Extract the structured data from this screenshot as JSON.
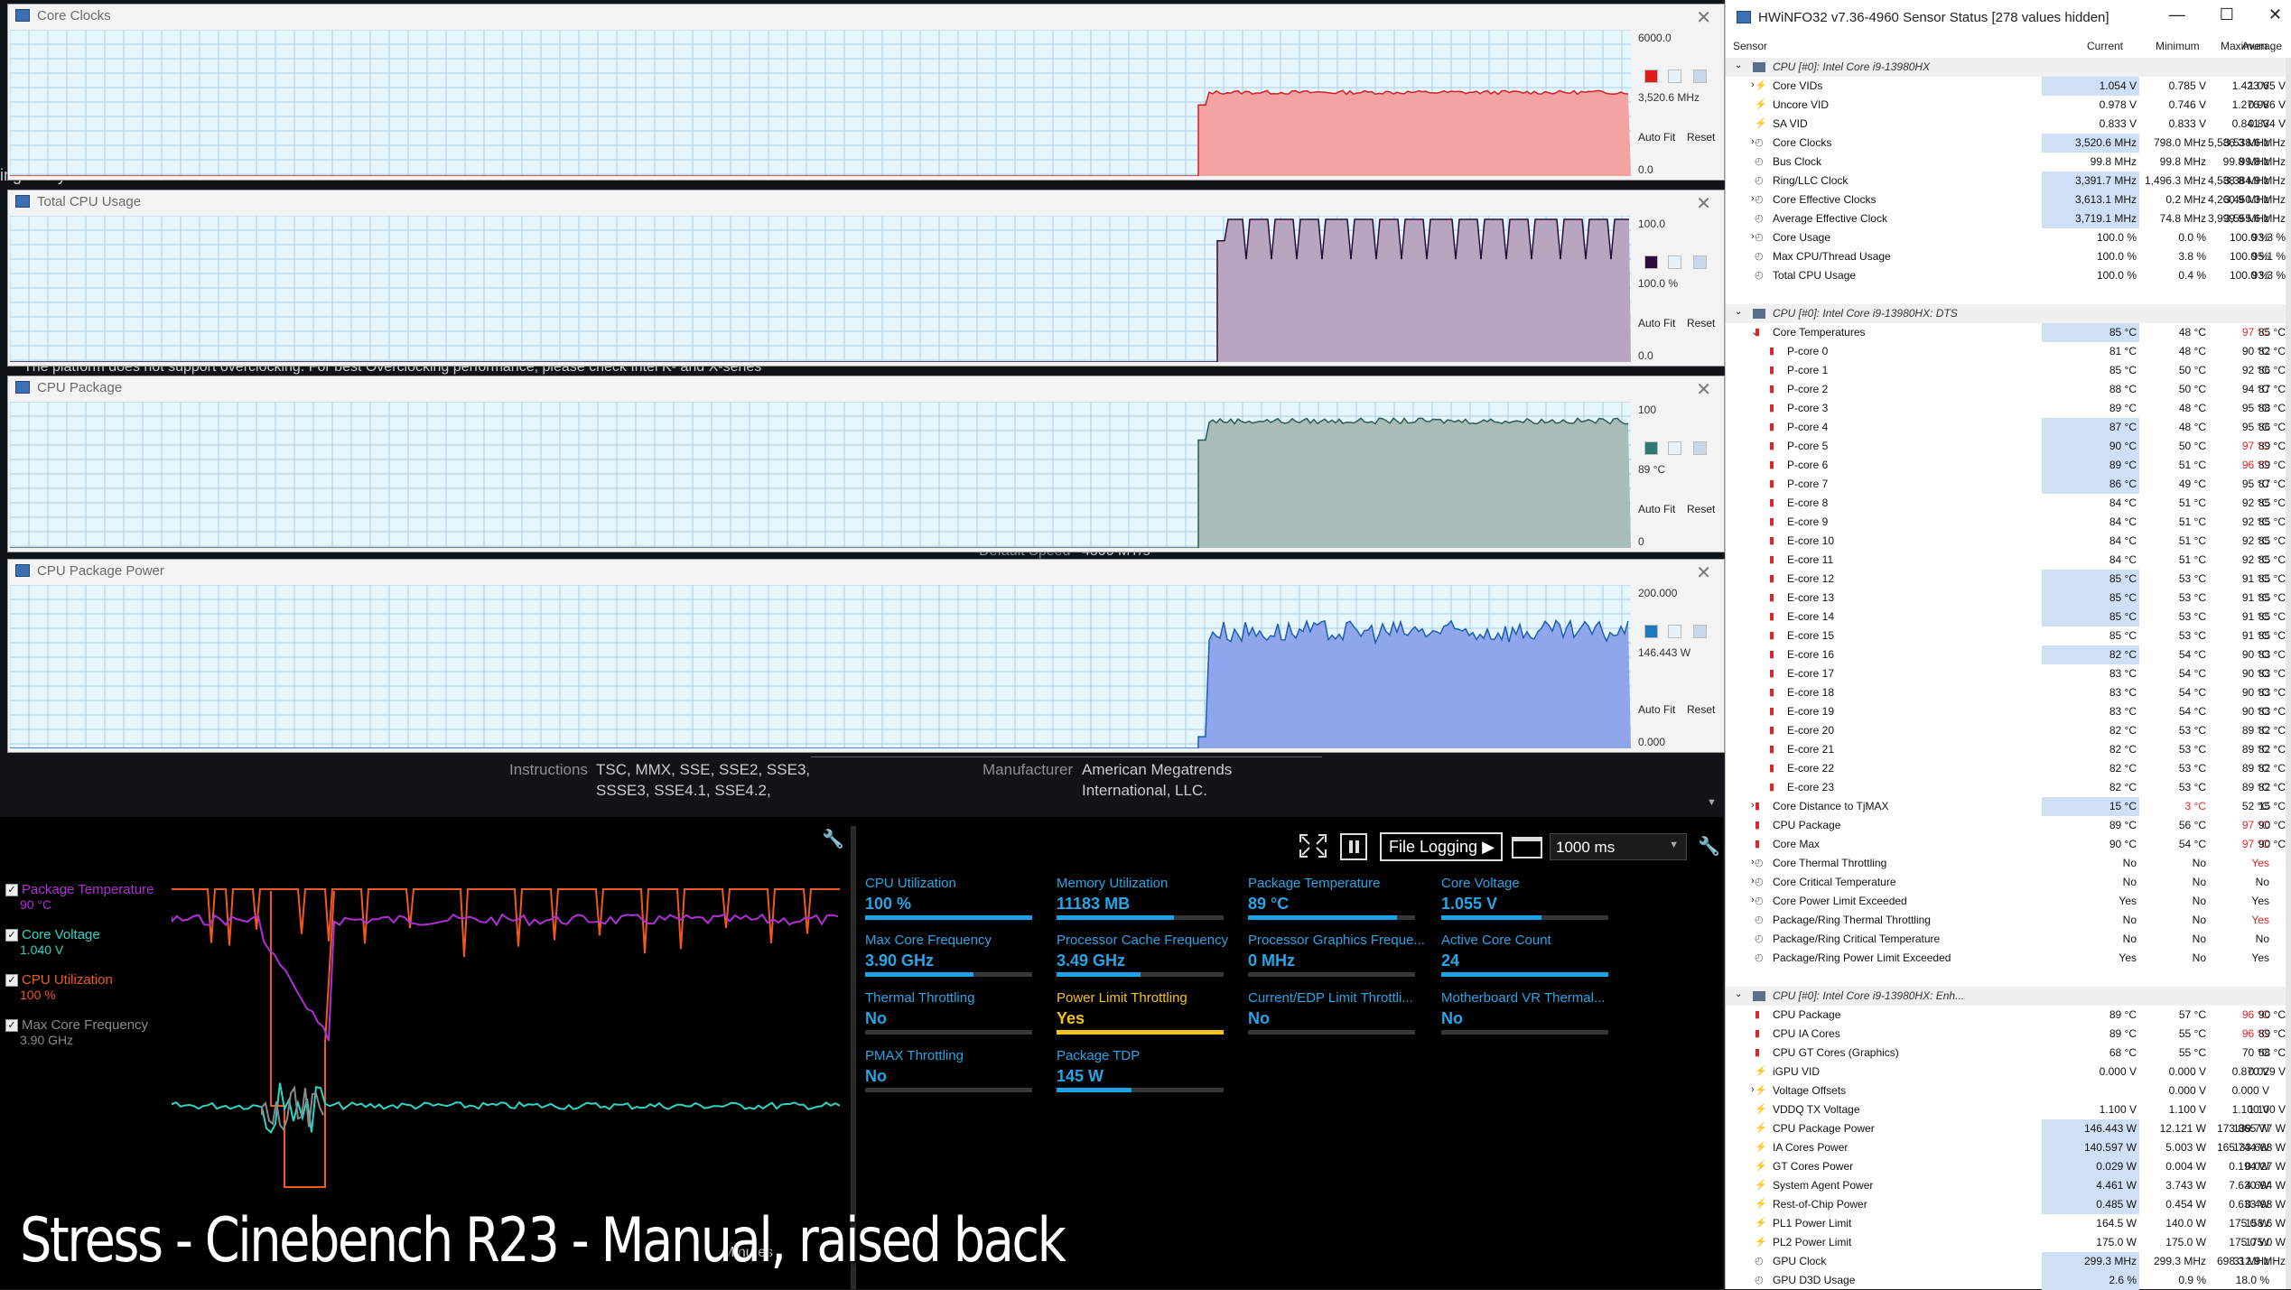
{
  "background_app": {
    "fragments": [
      {
        "text": "ing Utility",
        "cls": ""
      },
      {
        "text": "The platform does not support overclocking. For best Overclocking performance, please check Intel K- and X-series",
        "cls": ""
      },
      {
        "text": "Default Speed",
        "cls": "dim"
      },
      {
        "text": "4800 MT/s",
        "cls": ""
      },
      {
        "text": "Instructions",
        "cls": "dim"
      },
      {
        "text": "TSC, MMX, SSE, SSE2, SSE3,",
        "cls": ""
      },
      {
        "text": "SSSE3, SSE4.1, SSE4.2,",
        "cls": ""
      },
      {
        "text": "Manufacturer",
        "cls": "dim"
      },
      {
        "text": "American Megatrends",
        "cls": ""
      },
      {
        "text": "International, LLC.",
        "cls": ""
      }
    ]
  },
  "graph_windows": [
    {
      "title": "Core Clocks",
      "top_label": "6000.0",
      "current": "3,520.6 MHz",
      "bottom_label": "0.0",
      "autofit": "Auto Fit",
      "reset": "Reset",
      "line_color": "#d42020",
      "fill_color": "#f4a3a3",
      "swatch": "#e01b1b",
      "series": {
        "max": 6000,
        "idle": 0,
        "start_frac": 0.733,
        "level": 3520,
        "noise": 80,
        "dips": 0
      }
    },
    {
      "title": "Total CPU Usage",
      "top_label": "100.0",
      "current": "100.0 %",
      "bottom_label": "0.0",
      "autofit": "Auto Fit",
      "reset": "Reset",
      "line_color": "#2b0b3b",
      "fill_color": "#b8a6c0",
      "swatch": "#2b0b3b",
      "series": {
        "max": 100,
        "idle": 0,
        "start_frac": 0.745,
        "level": 100,
        "noise": 0,
        "dips": 16
      }
    },
    {
      "title": "CPU Package",
      "top_label": "100",
      "current": "89 °C",
      "bottom_label": "0",
      "autofit": "Auto Fit",
      "reset": "Reset",
      "line_color": "#2f5b52",
      "fill_color": "#a8bcb8",
      "swatch": "#2f7a70",
      "series": {
        "max": 100,
        "idle": 0,
        "start_frac": 0.733,
        "level": 89,
        "noise": 2,
        "dips": 0
      }
    },
    {
      "title": "CPU Package Power",
      "top_label": "200.000",
      "current": "146.443 W",
      "bottom_label": "0.000",
      "autofit": "Auto Fit",
      "reset": "Reset",
      "line_color": "#1f5eb0",
      "fill_color": "#8fa6ec",
      "swatch": "#1f7ac0",
      "series": {
        "max": 200,
        "idle": 0,
        "start_frac": 0.733,
        "level": 146,
        "noise": 14,
        "dips": 0
      }
    }
  ],
  "hwinfo": {
    "title": "HWiNFO32 v7.36-4960 Sensor Status [278 values hidden]",
    "window_buttons": [
      "—",
      "☐",
      "✕"
    ],
    "columns": [
      "Sensor",
      "Current",
      "Minimum",
      "Maximum",
      "Average"
    ],
    "rows": [
      {
        "t": "grp",
        "name": "CPU [#0]: Intel Core i9-13980HX"
      },
      {
        "name": "Core VIDs",
        "exp": true,
        "icon": "bolt",
        "cur": "1.054 V",
        "min": "0.785 V",
        "max": "1.423 V",
        "avg": "1.065 V",
        "hl": true
      },
      {
        "name": "Uncore VID",
        "icon": "bolt",
        "cur": "0.978 V",
        "min": "0.746 V",
        "max": "1.276 V",
        "avg": "0.986 V"
      },
      {
        "name": "SA VID",
        "icon": "bolt",
        "cur": "0.833 V",
        "min": "0.833 V",
        "max": "0.841 V",
        "avg": "0.834 V"
      },
      {
        "name": "Core Clocks",
        "exp": true,
        "icon": "clock",
        "cur": "3,520.6 MHz",
        "min": "798.0 MHz",
        "max": "5,586.3 MHz",
        "avg": "3,538.6 MHz",
        "hl": true
      },
      {
        "name": "Bus Clock",
        "icon": "clock",
        "cur": "99.8 MHz",
        "min": "99.8 MHz",
        "max": "99.8 MHz",
        "avg": "99.8 MHz"
      },
      {
        "name": "Ring/LLC Clock",
        "icon": "clock",
        "cur": "3,391.7 MHz",
        "min": "1,496.3 MHz",
        "max": "4,588.8 MHz",
        "avg": "3,384.9 MHz",
        "hl": true
      },
      {
        "name": "Core Effective Clocks",
        "exp": true,
        "icon": "clock",
        "cur": "3,613.1 MHz",
        "min": "0.2 MHz",
        "max": "4,260.9 MHz",
        "avg": "3,450.3 MHz",
        "hl": true
      },
      {
        "name": "Average Effective Clock",
        "icon": "clock",
        "cur": "3,719.1 MHz",
        "min": "74.8 MHz",
        "max": "3,999.9 MHz",
        "avg": "3,555.6 MHz",
        "hl": true
      },
      {
        "name": "Core Usage",
        "exp": true,
        "icon": "clock",
        "cur": "100.0 %",
        "min": "0.0 %",
        "max": "100.0 %",
        "avg": "93.3 %"
      },
      {
        "name": "Max CPU/Thread Usage",
        "icon": "clock",
        "cur": "100.0 %",
        "min": "3.8 %",
        "max": "100.0 %",
        "avg": "95.1 %"
      },
      {
        "name": "Total CPU Usage",
        "icon": "clock",
        "cur": "100.0 %",
        "min": "0.4 %",
        "max": "100.0 %",
        "avg": "93.3 %"
      },
      {
        "t": "blank"
      },
      {
        "t": "grp",
        "name": "CPU [#0]: Intel Core i9-13980HX: DTS"
      },
      {
        "name": "Core Temperatures",
        "exp": true,
        "open": true,
        "icon": "temp",
        "cur": "85 °C",
        "min": "48 °C",
        "max": "97 °C",
        "avg": "85 °C",
        "hl": true,
        "maxred": true
      },
      {
        "name": "P-core 0",
        "indent": true,
        "icon": "temp",
        "cur": "81 °C",
        "min": "48 °C",
        "max": "90 °C",
        "avg": "82 °C"
      },
      {
        "name": "P-core 1",
        "indent": true,
        "icon": "temp",
        "cur": "85 °C",
        "min": "50 °C",
        "max": "92 °C",
        "avg": "86 °C"
      },
      {
        "name": "P-core 2",
        "indent": true,
        "icon": "temp",
        "cur": "88 °C",
        "min": "50 °C",
        "max": "94 °C",
        "avg": "87 °C"
      },
      {
        "name": "P-core 3",
        "indent": true,
        "icon": "temp",
        "cur": "89 °C",
        "min": "48 °C",
        "max": "95 °C",
        "avg": "88 °C"
      },
      {
        "name": "P-core 4",
        "indent": true,
        "icon": "temp",
        "cur": "87 °C",
        "min": "48 °C",
        "max": "95 °C",
        "avg": "86 °C",
        "hl": true
      },
      {
        "name": "P-core 5",
        "indent": true,
        "icon": "temp",
        "cur": "90 °C",
        "min": "50 °C",
        "max": "97 °C",
        "avg": "89 °C",
        "hl": true,
        "maxred": true
      },
      {
        "name": "P-core 6",
        "indent": true,
        "icon": "temp",
        "cur": "89 °C",
        "min": "51 °C",
        "max": "96 °C",
        "avg": "89 °C",
        "hl": true,
        "maxred": true
      },
      {
        "name": "P-core 7",
        "indent": true,
        "icon": "temp",
        "cur": "86 °C",
        "min": "49 °C",
        "max": "95 °C",
        "avg": "87 °C",
        "hl": true
      },
      {
        "name": "E-core 8",
        "indent": true,
        "icon": "temp",
        "cur": "84 °C",
        "min": "51 °C",
        "max": "92 °C",
        "avg": "85 °C"
      },
      {
        "name": "E-core 9",
        "indent": true,
        "icon": "temp",
        "cur": "84 °C",
        "min": "51 °C",
        "max": "92 °C",
        "avg": "85 °C"
      },
      {
        "name": "E-core 10",
        "indent": true,
        "icon": "temp",
        "cur": "84 °C",
        "min": "51 °C",
        "max": "92 °C",
        "avg": "85 °C"
      },
      {
        "name": "E-core 11",
        "indent": true,
        "icon": "temp",
        "cur": "84 °C",
        "min": "51 °C",
        "max": "92 °C",
        "avg": "85 °C"
      },
      {
        "name": "E-core 12",
        "indent": true,
        "icon": "temp",
        "cur": "85 °C",
        "min": "53 °C",
        "max": "91 °C",
        "avg": "85 °C",
        "hl": true
      },
      {
        "name": "E-core 13",
        "indent": true,
        "icon": "temp",
        "cur": "85 °C",
        "min": "53 °C",
        "max": "91 °C",
        "avg": "85 °C",
        "hl": true
      },
      {
        "name": "E-core 14",
        "indent": true,
        "icon": "temp",
        "cur": "85 °C",
        "min": "53 °C",
        "max": "91 °C",
        "avg": "85 °C",
        "hl": true
      },
      {
        "name": "E-core 15",
        "indent": true,
        "icon": "temp",
        "cur": "85 °C",
        "min": "53 °C",
        "max": "91 °C",
        "avg": "85 °C"
      },
      {
        "name": "E-core 16",
        "indent": true,
        "icon": "temp",
        "cur": "82 °C",
        "min": "54 °C",
        "max": "90 °C",
        "avg": "83 °C",
        "hl": true
      },
      {
        "name": "E-core 17",
        "indent": true,
        "icon": "temp",
        "cur": "83 °C",
        "min": "54 °C",
        "max": "90 °C",
        "avg": "83 °C"
      },
      {
        "name": "E-core 18",
        "indent": true,
        "icon": "temp",
        "cur": "83 °C",
        "min": "54 °C",
        "max": "90 °C",
        "avg": "83 °C"
      },
      {
        "name": "E-core 19",
        "indent": true,
        "icon": "temp",
        "cur": "83 °C",
        "min": "54 °C",
        "max": "90 °C",
        "avg": "83 °C"
      },
      {
        "name": "E-core 20",
        "indent": true,
        "icon": "temp",
        "cur": "82 °C",
        "min": "53 °C",
        "max": "89 °C",
        "avg": "82 °C"
      },
      {
        "name": "E-core 21",
        "indent": true,
        "icon": "temp",
        "cur": "82 °C",
        "min": "53 °C",
        "max": "89 °C",
        "avg": "82 °C"
      },
      {
        "name": "E-core 22",
        "indent": true,
        "icon": "temp",
        "cur": "82 °C",
        "min": "53 °C",
        "max": "89 °C",
        "avg": "82 °C"
      },
      {
        "name": "E-core 23",
        "indent": true,
        "icon": "temp",
        "cur": "82 °C",
        "min": "53 °C",
        "max": "89 °C",
        "avg": "82 °C"
      },
      {
        "name": "Core Distance to TjMAX",
        "exp": true,
        "icon": "temp",
        "cur": "15 °C",
        "min": "3 °C",
        "max": "52 °C",
        "avg": "15 °C",
        "hl": true,
        "minred": true
      },
      {
        "name": "CPU Package",
        "icon": "temp",
        "cur": "89 °C",
        "min": "56 °C",
        "max": "97 °C",
        "avg": "90 °C",
        "maxred": true
      },
      {
        "name": "Core Max",
        "icon": "temp",
        "cur": "90 °C",
        "min": "54 °C",
        "max": "97 °C",
        "avg": "90 °C",
        "maxred": true
      },
      {
        "name": "Core Thermal Throttling",
        "exp": true,
        "icon": "clock",
        "cur": "No",
        "min": "No",
        "max": "Yes",
        "avg": "",
        "maxred": true
      },
      {
        "name": "Core Critical Temperature",
        "exp": true,
        "icon": "clock",
        "cur": "No",
        "min": "No",
        "max": "No",
        "avg": ""
      },
      {
        "name": "Core Power Limit Exceeded",
        "exp": true,
        "icon": "clock",
        "cur": "Yes",
        "min": "No",
        "max": "Yes",
        "avg": ""
      },
      {
        "name": "Package/Ring Thermal Throttling",
        "icon": "clock",
        "cur": "No",
        "min": "No",
        "max": "Yes",
        "avg": "",
        "maxred": true
      },
      {
        "name": "Package/Ring Critical Temperature",
        "icon": "clock",
        "cur": "No",
        "min": "No",
        "max": "No",
        "avg": ""
      },
      {
        "name": "Package/Ring Power Limit Exceeded",
        "icon": "clock",
        "cur": "Yes",
        "min": "No",
        "max": "Yes",
        "avg": ""
      },
      {
        "t": "blank"
      },
      {
        "t": "grp",
        "name": "CPU [#0]: Intel Core i9-13980HX: Enh..."
      },
      {
        "name": "CPU Package",
        "icon": "temp",
        "cur": "89 °C",
        "min": "57 °C",
        "max": "96 °C",
        "avg": "90 °C",
        "maxred": true
      },
      {
        "name": "CPU IA Cores",
        "icon": "temp",
        "cur": "89 °C",
        "min": "55 °C",
        "max": "96 °C",
        "avg": "89 °C",
        "maxred": true
      },
      {
        "name": "CPU GT Cores (Graphics)",
        "icon": "temp",
        "cur": "68 °C",
        "min": "55 °C",
        "max": "70 °C",
        "avg": "68 °C"
      },
      {
        "name": "iGPU VID",
        "icon": "bolt",
        "cur": "0.000 V",
        "min": "0.000 V",
        "max": "0.870 V",
        "avg": "0.029 V"
      },
      {
        "name": "Voltage Offsets",
        "exp": true,
        "icon": "bolt",
        "cur": "",
        "min": "0.000 V",
        "max": "0.000 V",
        "avg": ""
      },
      {
        "name": "VDDQ TX Voltage",
        "icon": "bolt",
        "cur": "1.100 V",
        "min": "1.100 V",
        "max": "1.100 V",
        "avg": "1.100 V"
      },
      {
        "name": "CPU Package Power",
        "icon": "bolt",
        "cur": "146.443 W",
        "min": "12.121 W",
        "max": "173.865 W",
        "avg": "139.777 W",
        "hl": true
      },
      {
        "name": "IA Cores Power",
        "icon": "bolt",
        "cur": "140.597 W",
        "min": "5.003 W",
        "max": "165.744 W",
        "avg": "133.688 W",
        "hl": true
      },
      {
        "name": "GT Cores Power",
        "icon": "bolt",
        "cur": "0.029 W",
        "min": "0.004 W",
        "max": "0.194 W",
        "avg": "0.027 W",
        "hl": true
      },
      {
        "name": "System Agent Power",
        "icon": "bolt",
        "cur": "4.461 W",
        "min": "3.743 W",
        "max": "7.630 W",
        "avg": "4.694 W",
        "hl": true
      },
      {
        "name": "Rest-of-Chip Power",
        "icon": "bolt",
        "cur": "0.485 W",
        "min": "0.454 W",
        "max": "0.633 W",
        "avg": "0.498 W",
        "hl": true
      },
      {
        "name": "PL1 Power Limit",
        "icon": "bolt",
        "cur": "164.5 W",
        "min": "140.0 W",
        "max": "175.0 W",
        "avg": "158.6 W"
      },
      {
        "name": "PL2 Power Limit",
        "icon": "bolt",
        "cur": "175.0 W",
        "min": "175.0 W",
        "max": "175.0 W",
        "avg": "175.0 W"
      },
      {
        "name": "GPU Clock",
        "icon": "clock",
        "cur": "299.3 MHz",
        "min": "299.3 MHz",
        "max": "698.3 MHz",
        "avg": "312.9 MHz",
        "hl": true
      },
      {
        "name": "GPU D3D Usage",
        "icon": "clock",
        "cur": "2.6 %",
        "min": "0.9 %",
        "max": "18.0 %",
        "avg": "",
        "hl": true
      }
    ]
  },
  "monitor": {
    "legend": [
      {
        "label": "Package Temperature",
        "value": "90 °C",
        "color": "#b02fd6"
      },
      {
        "label": "Core Voltage",
        "value": "1.040 V",
        "color": "#2fd4c4"
      },
      {
        "label": "CPU Utilization",
        "value": "100 %",
        "color": "#f05a1e"
      },
      {
        "label": "Max Core Frequency",
        "value": "3.90 GHz",
        "color": "#8a8a8a"
      }
    ],
    "check_mark": "✓",
    "toolbar": {
      "file_logging": "File Logging ▶",
      "interval": "1000 ms"
    },
    "minutes_label": "Minutes",
    "metrics": [
      {
        "label": "CPU Utilization",
        "value": "100 %",
        "fill": 1.0
      },
      {
        "label": "Memory Utilization",
        "value": "11183  MB",
        "fill": 0.7
      },
      {
        "label": "Package Temperature",
        "value": "89 °C",
        "fill": 0.89
      },
      {
        "label": "Core Voltage",
        "value": "1.055 V",
        "fill": 0.6
      },
      {
        "label": "Max Core Frequency",
        "value": "3.90 GHz",
        "fill": 0.65
      },
      {
        "label": "Processor Cache Frequency",
        "value": "3.49 GHz",
        "fill": 0.5
      },
      {
        "label": "Processor Graphics Freque...",
        "value": "0 MHz",
        "fill": 0.0
      },
      {
        "label": "Active Core Count",
        "value": "24",
        "fill": 1.0
      },
      {
        "label": "Thermal Throttling",
        "value": "No",
        "fill": 0.0
      },
      {
        "label": "Power Limit Throttling",
        "value": "Yes",
        "fill": 1.0,
        "yellow": true
      },
      {
        "label": "Current/EDP Limit Throttli...",
        "value": "No",
        "fill": 0.0
      },
      {
        "label": "Motherboard VR Thermal...",
        "value": "No",
        "fill": 0.0
      },
      {
        "label": "PMAX Throttling",
        "value": "No",
        "fill": 0.0
      },
      {
        "label": "Package TDP",
        "value": "145 W",
        "fill": 0.45
      }
    ]
  },
  "caption": "Stress - Cinebench R23 - Manual, raised back"
}
